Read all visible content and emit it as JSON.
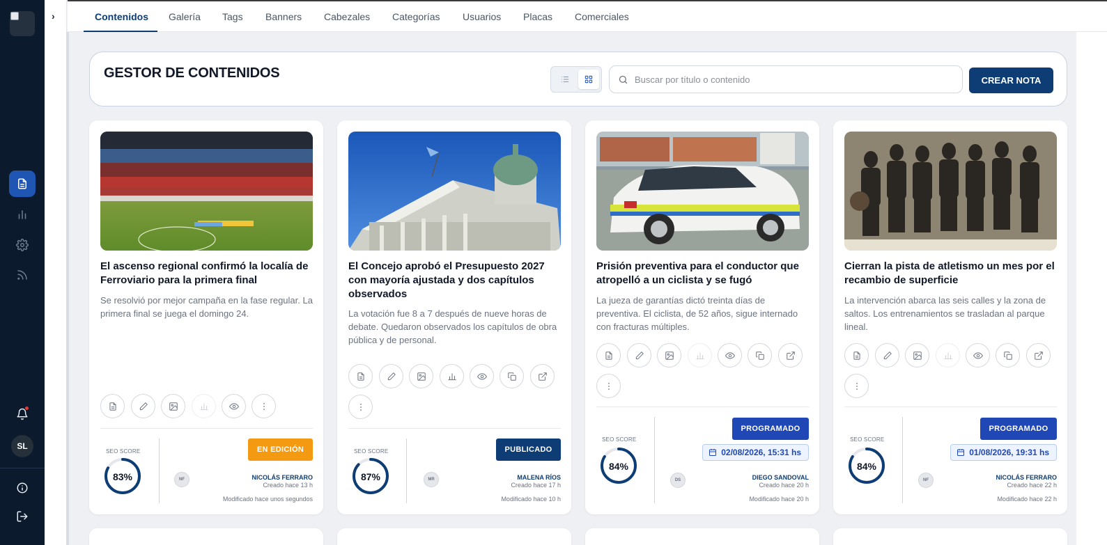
{
  "sidebar": {
    "user_initials": "SL",
    "items": [
      {
        "icon": "document-icon",
        "active": true
      },
      {
        "icon": "bar-chart-icon",
        "active": false
      },
      {
        "icon": "gear-icon",
        "active": false
      },
      {
        "icon": "rss-icon",
        "active": false
      }
    ],
    "bottom": [
      "bell-icon",
      "info-icon",
      "logout-icon"
    ]
  },
  "collapse": {
    "glyph": "›"
  },
  "tabs": [
    "Contenidos",
    "Galería",
    "Tags",
    "Banners",
    "Cabezales",
    "Categorías",
    "Usuarios",
    "Placas",
    "Comerciales"
  ],
  "active_tab": "Contenidos",
  "header": {
    "title": "GESTOR DE CONTENIDOS",
    "search_placeholder": "Buscar por título o contenido",
    "create_label": "CREAR NOTA",
    "view_mode": "grid"
  },
  "cards": [
    {
      "title": "El ascenso regional confirmó la localía de Ferroviario para la primera final",
      "description": "Se resolvió por mejor campaña en la fase regular. La primera final se juega el domingo 24.",
      "seo_label": "SEO SCORE",
      "seo": 83,
      "status": "EN EDICIÓN",
      "author_initials": "NF",
      "author": "NICOLÁS FERRARO",
      "created": "Creado hace 13 h",
      "modified": "Modificado hace unos segundos"
    },
    {
      "title": "El Concejo aprobó el Presupuesto 2027 con mayoría ajustada y dos capítulos observados",
      "description": "La votación fue 8 a 7 después de nueve horas de debate. Quedaron observados los capítulos de obra pública y de personal.",
      "seo_label": "SEO SCORE",
      "seo": 87,
      "status": "PUBLICADO",
      "author_initials": "MR",
      "author": "MALENA RÍOS",
      "created": "Creado hace 17 h",
      "modified": "Modificado hace 10 h"
    },
    {
      "title": "Prisión preventiva para el conductor que atropelló a un ciclista y se fugó",
      "description": "La jueza de garantías dictó treinta días de preventiva. El ciclista, de 52 años, sigue internado con fracturas múltiples.",
      "seo_label": "SEO SCORE",
      "seo": 84,
      "status": "PROGRAMADO",
      "scheduled": "02/08/2026, 15:31 hs",
      "author_initials": "DS",
      "author": "DIEGO SANDOVAL",
      "created": "Creado hace 20 h",
      "modified": "Modificado hace 20 h"
    },
    {
      "title": "Cierran la pista de atletismo un mes por el recambio de superficie",
      "description": "La intervención abarca las seis calles y la zona de saltos. Los entrenamientos se trasladan al parque lineal.",
      "seo_label": "SEO SCORE",
      "seo": 84,
      "status": "PROGRAMADO",
      "scheduled": "01/08/2026, 19:31 hs",
      "author_initials": "NF",
      "author": "NICOLÁS FERRARO",
      "created": "Creado hace 22 h",
      "modified": "Modificado hace 22 h"
    }
  ],
  "colors": {
    "sidebar_bg": "#0c1a2e",
    "primary": "#0d3d74",
    "scheduled": "#1f47b5",
    "editing": "#f39a12",
    "active_nav": "#1f56b3"
  }
}
